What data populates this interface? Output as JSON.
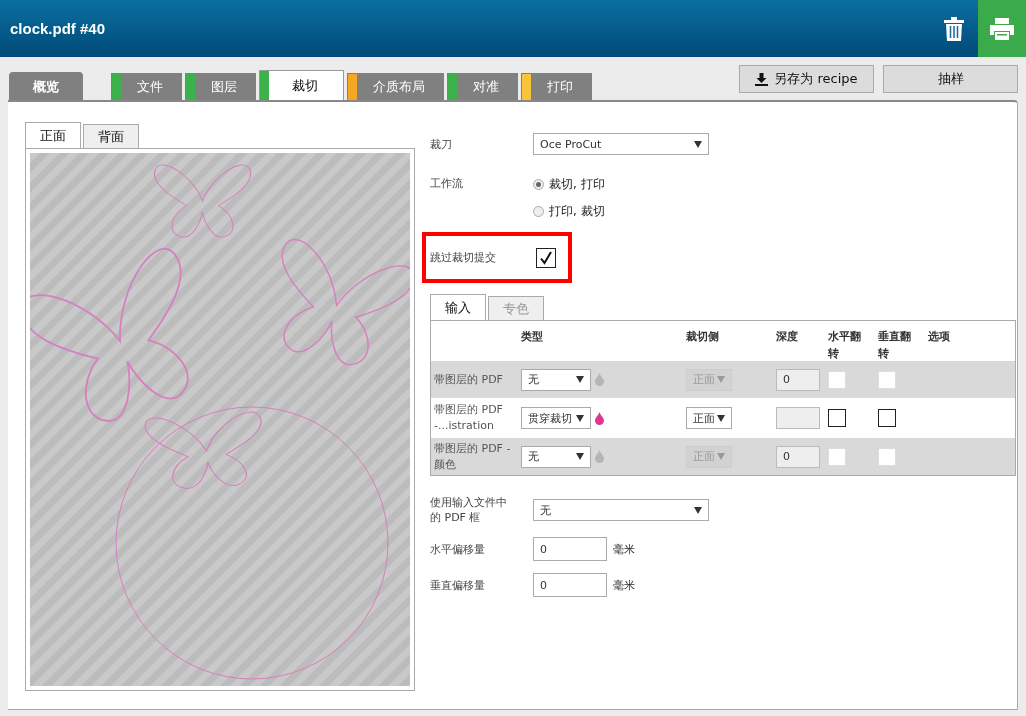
{
  "header": {
    "title": "clock.pdf #40"
  },
  "tabs": [
    {
      "label": "概览",
      "kind": "overview",
      "selected": false
    },
    {
      "label": "文件",
      "kind": "step",
      "color": "#3cb34a",
      "selected": false
    },
    {
      "label": "图层",
      "kind": "step",
      "color": "#3cb34a",
      "selected": false
    },
    {
      "label": "裁切",
      "kind": "step",
      "color": "#3cb34a",
      "selected": true
    },
    {
      "label": "介质布局",
      "kind": "step",
      "color": "#f5a623",
      "selected": false
    },
    {
      "label": "对准",
      "kind": "step",
      "color": "#3cb34a",
      "selected": false
    },
    {
      "label": "打印",
      "kind": "step",
      "color": "#f8c43a",
      "selected": false
    }
  ],
  "actions": [
    {
      "label": "另存为 recipe",
      "kind": "save"
    },
    {
      "label": "抽样",
      "kind": "plain"
    }
  ],
  "preview": {
    "tabs": [
      {
        "label": "正面",
        "selected": true
      },
      {
        "label": "背面",
        "selected": false
      }
    ]
  },
  "form": {
    "cutter": {
      "label": "裁刀",
      "value": "Oce ProCut"
    },
    "workflow": {
      "label": "工作流",
      "options": [
        {
          "label": "裁切, 打印",
          "selected": true
        },
        {
          "label": "打印, 裁切",
          "selected": false
        }
      ]
    },
    "skip_submit": {
      "label": "跳过裁切提交",
      "checked": true,
      "highlighted": true
    },
    "layers": {
      "tabs": [
        {
          "label": "输入",
          "selected": true,
          "disabled": false
        },
        {
          "label": "专色",
          "selected": false,
          "disabled": true
        }
      ],
      "columns": [
        "类型",
        "裁切侧",
        "深度",
        "水平翻转",
        "垂直翻转",
        "选项"
      ],
      "rows": [
        {
          "name": "带图层的 PDF",
          "type": "无",
          "side": "正面",
          "depth": "0",
          "disabled": true,
          "h_flip": false,
          "v_flip": false
        },
        {
          "name": "带图层的 PDF -...istration",
          "type": "贯穿裁切",
          "side": "正面",
          "disabled": false,
          "h_flip": false,
          "v_flip": false
        },
        {
          "name": "带图层的 PDF - 颜色",
          "type": "无",
          "side": "正面",
          "depth": "0",
          "disabled": true,
          "h_flip": false,
          "v_flip": false
        }
      ]
    },
    "pdf_box": {
      "label": "使用输入文件中的 PDF 框",
      "value": "无"
    },
    "offsets": [
      {
        "label": "水平偏移量",
        "value": "0",
        "unit": "毫米"
      },
      {
        "label": "垂直偏移量",
        "value": "0",
        "unit": "毫米"
      }
    ]
  }
}
